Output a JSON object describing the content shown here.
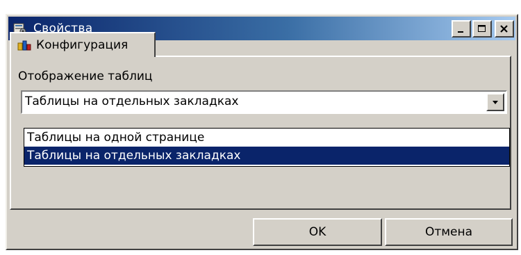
{
  "window": {
    "title": "Свойства",
    "icon": "properties-icon",
    "controls": {
      "minimize_label": "_",
      "maximize_label": "□",
      "close_label": "✕"
    }
  },
  "tabs": [
    {
      "label": "Конфигурация",
      "icon": "configuration-icon",
      "active": true
    }
  ],
  "panel": {
    "group_label": "Отображение таблиц",
    "combo": {
      "value": "Таблицы на отдельных закладках",
      "options": [
        {
          "label": "Таблицы на одной странице",
          "selected": false
        },
        {
          "label": "Таблицы на отдельных закладках",
          "selected": true
        }
      ]
    }
  },
  "buttons": {
    "ok_label": "OK",
    "cancel_label": "Отмена"
  },
  "colors": {
    "title_bar_start": "#0a246a",
    "title_bar_end": "#a6caf0",
    "selection": "#0a246a",
    "face": "#d4d0c8"
  }
}
